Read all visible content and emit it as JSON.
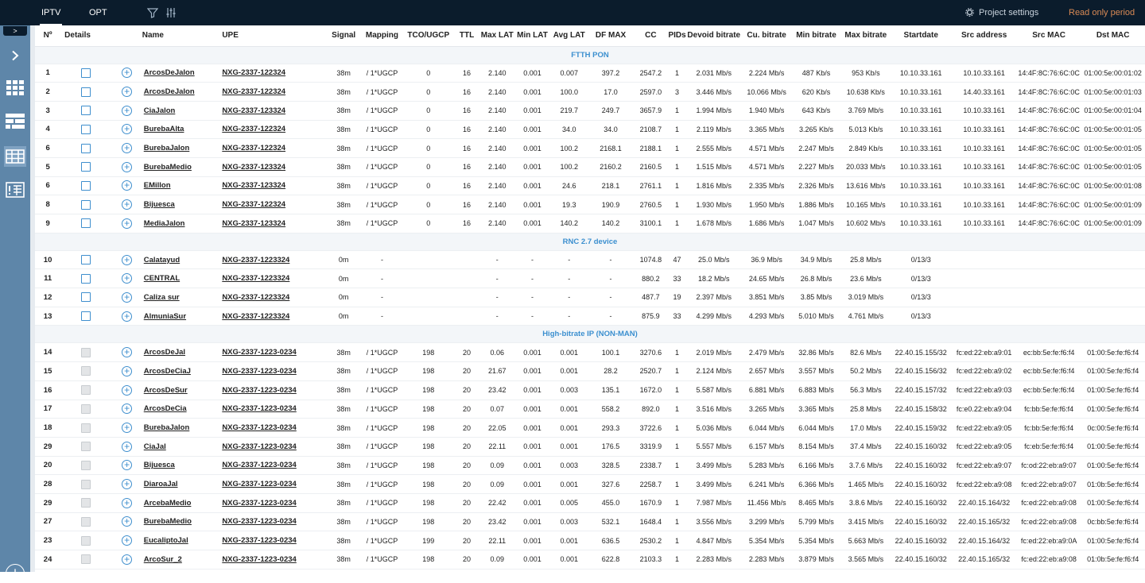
{
  "topbar": {
    "tabs": [
      "IPTV",
      "OPT"
    ],
    "project_settings": "Project settings",
    "read_only": "Read only period"
  },
  "sidebar": {
    "collapse": ">",
    "icons": [
      "chevron-right-icon",
      "grid-icon",
      "dashboard-icon",
      "table-icon",
      "report-icon"
    ],
    "add": "+"
  },
  "columns": [
    "Nº",
    "Details",
    "Name",
    "UPE",
    "Signal",
    "Mapping",
    "TCO/UGCP",
    "TTL",
    "Max LAT",
    "Min LAT",
    "Avg LAT",
    "DF MAX",
    "CC",
    "PIDs",
    "Devoid bitrate",
    "Cu. bitrate",
    "Min bitrate",
    "Max bitrate",
    "Startdate",
    "Src address",
    "Src MAC",
    "Dst MAC"
  ],
  "groups": [
    {
      "title": "FTTH PON",
      "rows": [
        [
          "1",
          "",
          "ArcosDeJalon",
          "NXG-2337-122324",
          "38m",
          "/ 1*UGCP",
          "0",
          "16",
          "2.140",
          "0.001",
          "0.007",
          "397.2",
          "2547.2",
          "1",
          "2.031 Mb/s",
          "2.224 Mb/s",
          "487 Kb/s",
          "953 Kb/s",
          "10.10.33.161",
          "10.10.33.161",
          "14:4F:8C:76:6C:0C",
          "01:00:5e:00:01:02"
        ],
        [
          "2",
          "",
          "ArcosDeJalon",
          "NXG-2337-122324",
          "38m",
          "/ 1*UGCP",
          "0",
          "16",
          "2.140",
          "0.001",
          "100.0",
          "17.0",
          "2597.0",
          "3",
          "3.446 Mb/s",
          "10.066 Mb/s",
          "620 Kb/s",
          "10.638 Kb/s",
          "10.10.33.161",
          "14.40.33.161",
          "14:4F:8C:76:6C:0C",
          "01:00:5e:00:01:03"
        ],
        [
          "3",
          "",
          "CiaJalon",
          "NXG-2337-123324",
          "38m",
          "/ 1*UGCP",
          "0",
          "16",
          "2.140",
          "0.001",
          "219.7",
          "249.7",
          "3657.9",
          "1",
          "1.994 Mb/s",
          "1.940 Mb/s",
          "643 Kb/s",
          "3.769 Mb/s",
          "10.10.33.161",
          "10.10.33.161",
          "14:4F:8C:76:6C:0C",
          "01:00:5e:00:01:04"
        ],
        [
          "4",
          "",
          "BurebaAlta",
          "NXG-2337-122324",
          "38m",
          "/ 1*UGCP",
          "0",
          "16",
          "2.140",
          "0.001",
          "34.0",
          "34.0",
          "2108.7",
          "1",
          "2.119 Mb/s",
          "3.365 Mb/s",
          "3.265 Kb/s",
          "5.013 Kb/s",
          "10.10.33.161",
          "10.10.33.161",
          "14:4F:8C:76:6C:0C",
          "01:00:5e:00:01:05"
        ],
        [
          "6",
          "",
          "BurebaJalon",
          "NXG-2337-122324",
          "38m",
          "/ 1*UGCP",
          "0",
          "16",
          "2.140",
          "0.001",
          "100.2",
          "2168.1",
          "2188.1",
          "1",
          "2.555 Mb/s",
          "4.571 Mb/s",
          "2.247 Mb/s",
          "2.849 Kb/s",
          "10.10.33.161",
          "10.10.33.161",
          "14:4F:8C:76:6C:0C",
          "01:00:5e:00:01:05"
        ],
        [
          "5",
          "",
          "BurebaMedio",
          "NXG-2337-123324",
          "38m",
          "/ 1*UGCP",
          "0",
          "16",
          "2.140",
          "0.001",
          "100.2",
          "2160.2",
          "2160.5",
          "1",
          "1.515 Mb/s",
          "4.571 Mb/s",
          "2.227 Mb/s",
          "20.033 Mb/s",
          "10.10.33.161",
          "10.10.33.161",
          "14:4F:8C:76:6C:0C",
          "01:00:5e:00:01:05"
        ],
        [
          "6",
          "",
          "EMillon",
          "NXG-2337-123324",
          "38m",
          "/ 1*UGCP",
          "0",
          "16",
          "2.140",
          "0.001",
          "24.6",
          "218.1",
          "2761.1",
          "1",
          "1.816 Mb/s",
          "2.335 Mb/s",
          "2.326 Mb/s",
          "13.616 Mb/s",
          "10.10.33.161",
          "10.10.33.161",
          "14:4F:8C:76:6C:0C",
          "01:00:5e:00:01:08"
        ],
        [
          "8",
          "",
          "Bijuesca",
          "NXG-2337-122324",
          "38m",
          "/ 1*UGCP",
          "0",
          "16",
          "2.140",
          "0.001",
          "19.3",
          "190.9",
          "2760.5",
          "1",
          "1.930 Mb/s",
          "1.950 Mb/s",
          "1.886 Mb/s",
          "10.165 Mb/s",
          "10.10.33.161",
          "10.10.33.161",
          "14:4F:8C:76:6C:0C",
          "01:00:5e:00:01:09"
        ],
        [
          "9",
          "",
          "MediaJalon",
          "NXG-2337-123324",
          "38m",
          "/ 1*UGCP",
          "0",
          "16",
          "2.140",
          "0.001",
          "140.2",
          "140.2",
          "3100.1",
          "1",
          "1.678 Mb/s",
          "1.686 Mb/s",
          "1.047 Mb/s",
          "10.602 Mb/s",
          "10.10.33.161",
          "10.10.33.161",
          "14:4F:8C:76:6C:0C",
          "01:00:5e:00:01:09"
        ]
      ]
    },
    {
      "title": "RNC 2.7 device",
      "rows": [
        [
          "10",
          "",
          "Calatayud",
          "NXG-2337-1223324",
          "0m",
          "-",
          "",
          "",
          "-",
          "-",
          "-",
          "-",
          "1074.8",
          "47",
          "25.0 Mb/s",
          "36.9 Mb/s",
          "34.9 Mb/s",
          "25.8 Mb/s",
          "0/13/3",
          "",
          "",
          ""
        ],
        [
          "11",
          "",
          "CENTRAL",
          "NXG-2337-1223324",
          "0m",
          "-",
          "",
          "",
          "-",
          "-",
          "-",
          "-",
          "880.2",
          "33",
          "18.2 Mb/s",
          "24.65 Mb/s",
          "26.8 Mb/s",
          "23.6 Mb/s",
          "0/13/3",
          "",
          "",
          ""
        ],
        [
          "12",
          "",
          "Caliza sur",
          "NXG-2337-1223324",
          "0m",
          "-",
          "",
          "",
          "-",
          "-",
          "-",
          "-",
          "487.7",
          "19",
          "2.397 Mb/s",
          "3.851 Mb/s",
          "3.85 Mb/s",
          "3.019 Mb/s",
          "0/13/3",
          "",
          "",
          ""
        ],
        [
          "13",
          "",
          "AlmuniaSur",
          "NXG-2337-1223324",
          "0m",
          "-",
          "",
          "",
          "-",
          "-",
          "-",
          "-",
          "875.9",
          "33",
          "4.299 Mb/s",
          "4.293 Mb/s",
          "5.010 Mb/s",
          "4.761 Mb/s",
          "0/13/3",
          "",
          "",
          ""
        ]
      ]
    },
    {
      "title": "High-bitrate IP (NON-MAN)",
      "rows": [
        [
          "14",
          "",
          "ArcosDeJal",
          "NXG-2337-1223-0234",
          "38m",
          "/ 1*UGCP",
          "198",
          "20",
          "0.06",
          "0.001",
          "0.001",
          "100.1",
          "3270.6",
          "1",
          "2.019 Mb/s",
          "2.479 Mb/s",
          "32.86 Mb/s",
          "82.6 Mb/s",
          "22.40.15.155/32",
          "fc:ed:22:eb:a9:01",
          "ec:bb:5e:fe:f6:f4",
          "01:00:5e:fe:f6:f4"
        ],
        [
          "15",
          "",
          "ArcosDeCiaJ",
          "NXG-2337-1223-0234",
          "38m",
          "/ 1*UGCP",
          "198",
          "20",
          "21.67",
          "0.001",
          "0.001",
          "28.2",
          "2520.7",
          "1",
          "2.124 Mb/s",
          "2.657 Mb/s",
          "3.557 Mb/s",
          "50.2 Mb/s",
          "22.40.15.156/32",
          "fc:ed:22:eb:a9:02",
          "ec:bb:5e:fe:f6:f4",
          "01:00:5e:fe:f6:f4"
        ],
        [
          "16",
          "",
          "ArcosDeSur",
          "NXG-2337-1223-0234",
          "38m",
          "/ 1*UGCP",
          "198",
          "20",
          "23.42",
          "0.001",
          "0.003",
          "135.1",
          "1672.0",
          "1",
          "5.587 Mb/s",
          "6.881 Mb/s",
          "6.883 Mb/s",
          "56.3 Mb/s",
          "22.40.15.157/32",
          "fc:ed:22:eb:a9:03",
          "ec:bb:5e:fe:f6:f4",
          "01:00:5e:fe:f6:f4"
        ],
        [
          "17",
          "",
          "ArcosDeCia",
          "NXG-2337-1223-0234",
          "38m",
          "/ 1*UGCP",
          "198",
          "20",
          "0.07",
          "0.001",
          "0.001",
          "558.2",
          "892.0",
          "1",
          "3.516 Mb/s",
          "3.265 Mb/s",
          "3.365 Mb/s",
          "25.8 Mb/s",
          "22.40.15.158/32",
          "fc:e0.22:eb:a9:04",
          "fc:bb:5e:fe:f6:f4",
          "01:00:5e:fe:f6:f4"
        ],
        [
          "18",
          "",
          "BurebaJalon",
          "NXG-2337-1223-0234",
          "38m",
          "/ 1*UGCP",
          "198",
          "20",
          "22.05",
          "0.001",
          "0.001",
          "293.3",
          "3722.6",
          "1",
          "5.036 Mb/s",
          "6.044 Mb/s",
          "6.044 Mb/s",
          "17.0 Mb/s",
          "22.40.15.159/32",
          "fc:ed:22:eb:a9:05",
          "fc:bb:5e:fe:f6:f4",
          "0c:00:5e:fe:f6:f4"
        ],
        [
          "29",
          "",
          "CiaJal",
          "NXG-2337-1223-0234",
          "38m",
          "/ 1*UGCP",
          "198",
          "20",
          "22.11",
          "0.001",
          "0.001",
          "176.5",
          "3319.9",
          "1",
          "5.557 Mb/s",
          "6.157 Mb/s",
          "8.154 Mb/s",
          "37.4 Mb/s",
          "22.40.15.160/32",
          "fc:ed:22:eb:a9:05",
          "fc:eb:5e:fe:f6:f4",
          "01:00:5e:fe:f6:f4"
        ],
        [
          "20",
          "",
          "Bijuesca",
          "NXG-2337-1223-0234",
          "38m",
          "/ 1*UGCP",
          "198",
          "20",
          "0.09",
          "0.001",
          "0.003",
          "328.5",
          "2338.7",
          "1",
          "3.499 Mb/s",
          "5.283 Mb/s",
          "6.166 Mb/s",
          "3.7.6 Mb/s",
          "22.40.15.160/32",
          "fc:ed:22:eb:a9:07",
          "fc:od:22:eb:a9:07",
          "01:00:5e:fe:f6:f4"
        ],
        [
          "28",
          "",
          "DiaroaJal",
          "NXG-2337-1223-0234",
          "38m",
          "/ 1*UGCP",
          "198",
          "20",
          "0.09",
          "0.001",
          "0.001",
          "327.6",
          "2258.7",
          "1",
          "3.499 Mb/s",
          "6.241 Mb/s",
          "6.366 Mb/s",
          "1.465 Mb/s",
          "22.40.15.160/32",
          "fc:ed:22:eb:a9:08",
          "fc:ed:22:eb:a9:07",
          "01:0b:5e:fe:f6:f4"
        ],
        [
          "29",
          "",
          "ArcebaMedio",
          "NXG-2337-1223-0234",
          "38m",
          "/ 1*UGCP",
          "198",
          "20",
          "22.42",
          "0.001",
          "0.005",
          "455.0",
          "1670.9",
          "1",
          "7.987 Mb/s",
          "11.456 Mb/s",
          "8.465 Mb/s",
          "3.8.6 Mb/s",
          "22.40.15.160/32",
          "22.40.15.164/32",
          "fc:ed:22:eb:a9:08",
          "01:00:5e:fe:f6:f4"
        ],
        [
          "27",
          "",
          "BurebaMedio",
          "NXG-2337-1223-0234",
          "38m",
          "/ 1*UGCP",
          "198",
          "20",
          "23.42",
          "0.001",
          "0.003",
          "532.1",
          "1648.4",
          "1",
          "3.556 Mb/s",
          "3.299 Mb/s",
          "5.799 Mb/s",
          "3.415 Mb/s",
          "22.40.15.160/32",
          "22.40.15.165/32",
          "fc:ed:22:eb:a9:08",
          "0c:bb:5e:fe:f6:f4"
        ],
        [
          "23",
          "",
          "EucaliptoJal",
          "NXG-2337-1223-0234",
          "38m",
          "/ 1*UGCP",
          "199",
          "20",
          "22.11",
          "0.001",
          "0.001",
          "636.5",
          "2530.2",
          "1",
          "4.847 Mb/s",
          "5.354 Mb/s",
          "5.354 Mb/s",
          "5.663 Mb/s",
          "22.40.15.160/32",
          "22.40.15.164/32",
          "fc:ed:22:eb:a9:0A",
          "01:00:5e:fe:f6:f4"
        ],
        [
          "24",
          "",
          "ArcoSur_2",
          "NXG-2337-1223-0234",
          "38m",
          "/ 1*UGCP",
          "198",
          "20",
          "0.09",
          "0.001",
          "0.001",
          "622.8",
          "2103.3",
          "1",
          "2.283 Mb/s",
          "2.283 Mb/s",
          "3.879 Mb/s",
          "3.565 Mb/s",
          "22.40.15.160/32",
          "22.40.15.165/32",
          "fc:ed:22:eb:a9:08",
          "01:0b:5e:fe:f6:f4"
        ]
      ]
    }
  ]
}
